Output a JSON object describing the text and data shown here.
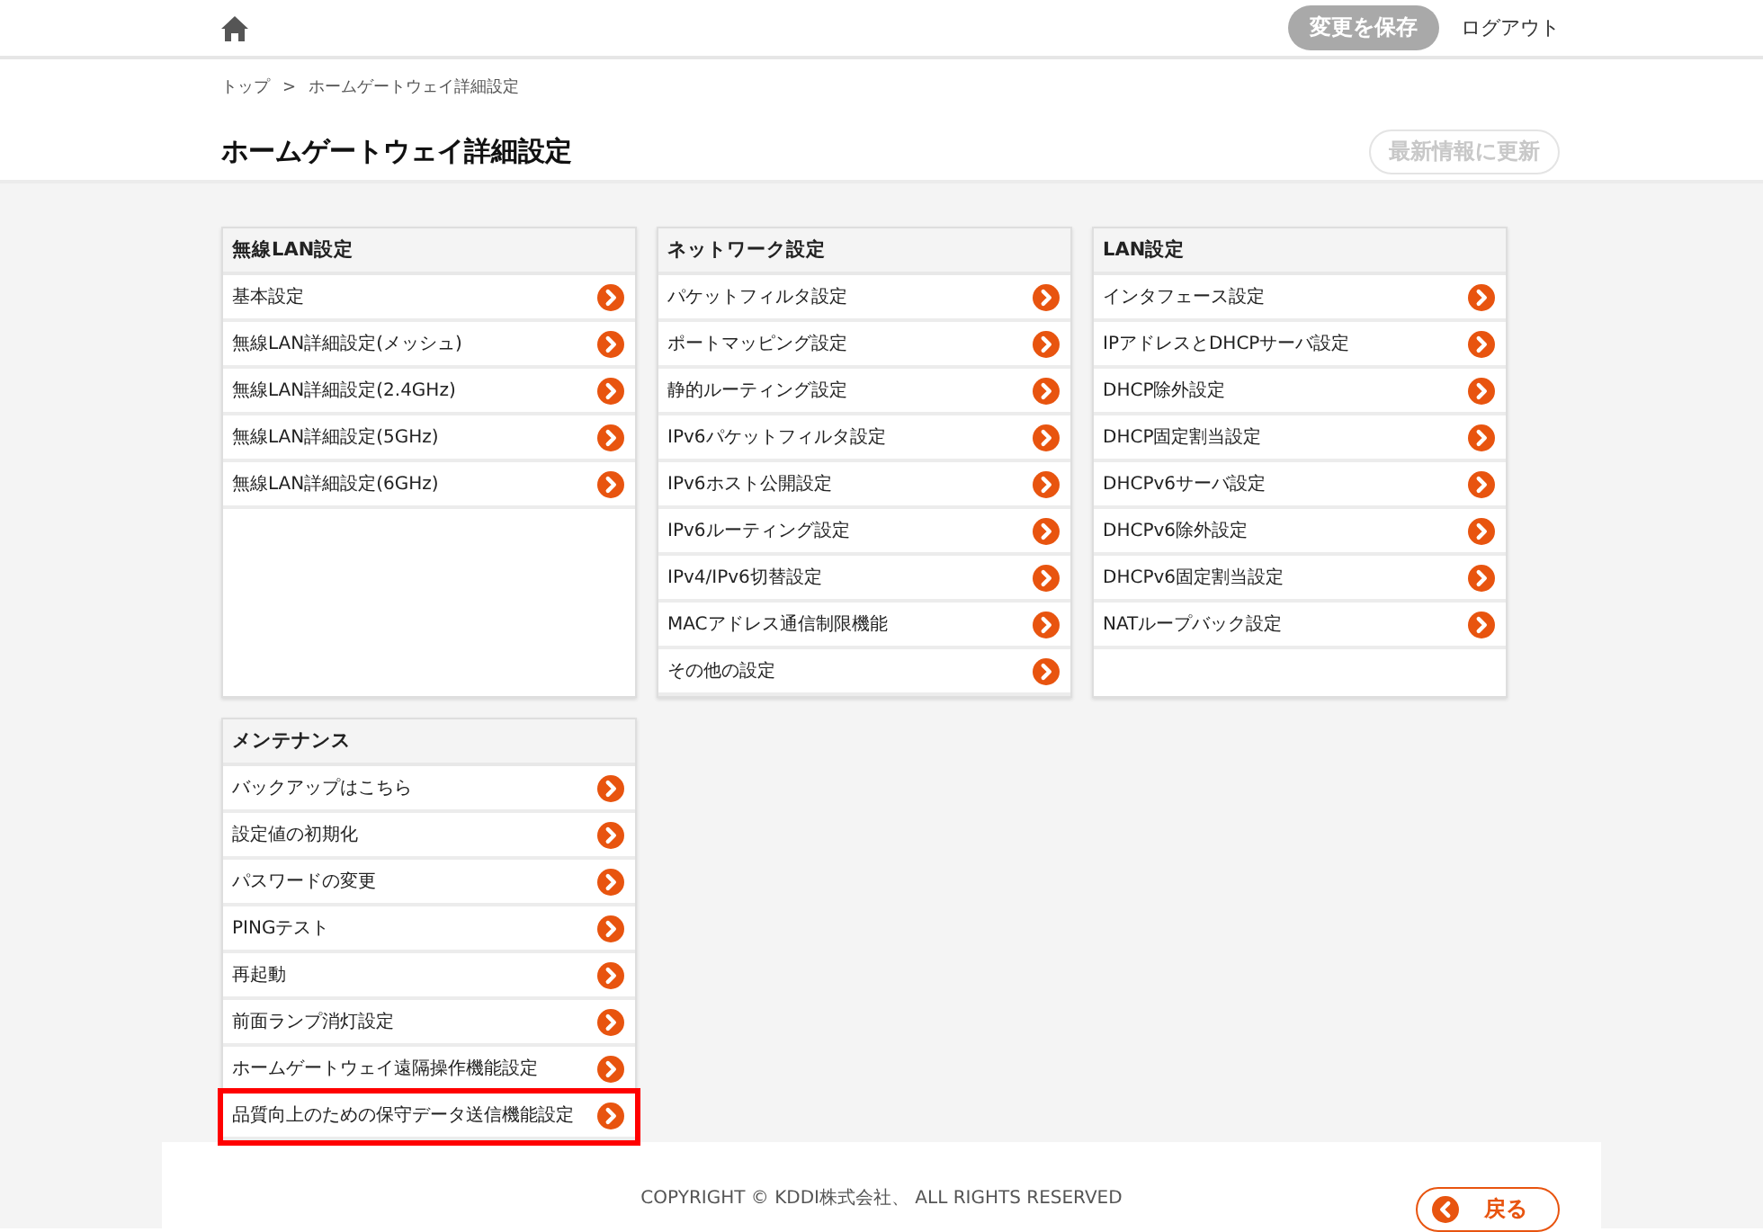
{
  "header": {
    "save_button": {
      "label": "変更を保存",
      "disabled": true
    },
    "logout": "ログアウト"
  },
  "breadcrumb": {
    "items": [
      "トップ",
      "ホームゲートウェイ詳細設定"
    ],
    "separator": ">"
  },
  "title": "ホームゲートウェイ詳細設定",
  "refresh_button": {
    "label": "最新情報に更新",
    "disabled": true
  },
  "cards": [
    {
      "title": "無線LAN設定",
      "items": [
        {
          "label": "基本設定",
          "highlighted": false
        },
        {
          "label": "無線LAN詳細設定(メッシュ)",
          "highlighted": false
        },
        {
          "label": "無線LAN詳細設定(2.4GHz)",
          "highlighted": false
        },
        {
          "label": "無線LAN詳細設定(5GHz)",
          "highlighted": false
        },
        {
          "label": "無線LAN詳細設定(6GHz)",
          "highlighted": false
        }
      ]
    },
    {
      "title": "ネットワーク設定",
      "items": [
        {
          "label": "パケットフィルタ設定",
          "highlighted": false
        },
        {
          "label": "ポートマッピング設定",
          "highlighted": false
        },
        {
          "label": "静的ルーティング設定",
          "highlighted": false
        },
        {
          "label": "IPv6パケットフィルタ設定",
          "highlighted": false
        },
        {
          "label": "IPv6ホスト公開設定",
          "highlighted": false
        },
        {
          "label": "IPv6ルーティング設定",
          "highlighted": false
        },
        {
          "label": "IPv4/IPv6切替設定",
          "highlighted": false
        },
        {
          "label": "MACアドレス通信制限機能",
          "highlighted": false
        },
        {
          "label": "その他の設定",
          "highlighted": false
        }
      ]
    },
    {
      "title": "LAN設定",
      "items": [
        {
          "label": "インタフェース設定",
          "highlighted": false
        },
        {
          "label": "IPアドレスとDHCPサーバ設定",
          "highlighted": false
        },
        {
          "label": "DHCP除外設定",
          "highlighted": false
        },
        {
          "label": "DHCP固定割当設定",
          "highlighted": false
        },
        {
          "label": "DHCPv6サーバ設定",
          "highlighted": false
        },
        {
          "label": "DHCPv6除外設定",
          "highlighted": false
        },
        {
          "label": "DHCPv6固定割当設定",
          "highlighted": false
        },
        {
          "label": "NATループバック設定",
          "highlighted": false
        }
      ]
    },
    {
      "title": "メンテナンス",
      "items": [
        {
          "label": "バックアップはこちら",
          "highlighted": false
        },
        {
          "label": "設定値の初期化",
          "highlighted": false
        },
        {
          "label": "パスワードの変更",
          "highlighted": false
        },
        {
          "label": "PINGテスト",
          "highlighted": false
        },
        {
          "label": "再起動",
          "highlighted": false
        },
        {
          "label": "前面ランプ消灯設定",
          "highlighted": false
        },
        {
          "label": "ホームゲートウェイ遠隔操作機能設定",
          "highlighted": false
        },
        {
          "label": "品質向上のための保守データ送信機能設定",
          "highlighted": true
        }
      ]
    }
  ],
  "footer": {
    "copyright": "COPYRIGHT © KDDI株式会社、 ALL RIGHTS RESERVED",
    "back_button": "戻る"
  }
}
